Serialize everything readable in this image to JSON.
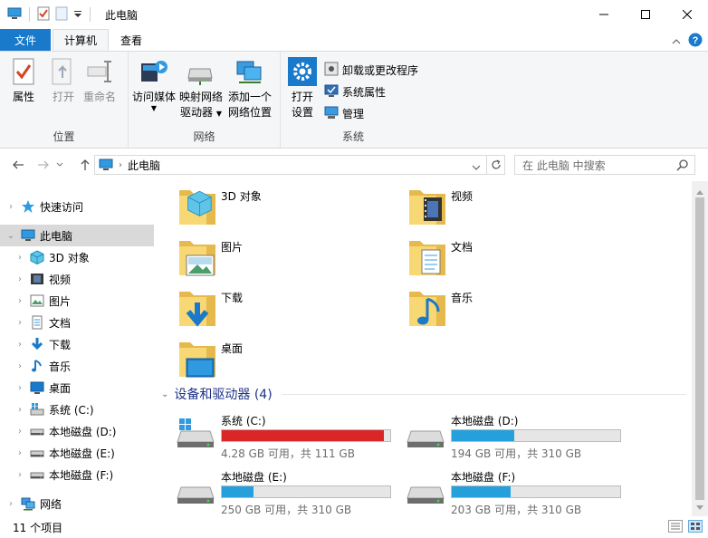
{
  "window": {
    "title": "此电脑"
  },
  "ribbon_tabs": {
    "file": "文件",
    "computer": "计算机",
    "view": "查看"
  },
  "ribbon": {
    "location": {
      "label": "位置",
      "properties": "属性",
      "open": "打开",
      "rename": "重命名"
    },
    "network": {
      "label": "网络",
      "access_media": "访问媒体",
      "map_drive_line1": "映射网络",
      "map_drive_line2": "驱动器",
      "add_location_line1": "添加一个",
      "add_location_line2": "网络位置"
    },
    "system": {
      "label": "系统",
      "open_settings_line1": "打开",
      "open_settings_line2": "设置",
      "uninstall": "卸载或更改程序",
      "system_properties": "系统属性",
      "manage": "管理"
    }
  },
  "address": {
    "crumb": "此电脑",
    "search_placeholder": "在 此电脑 中搜索"
  },
  "navpane": {
    "quick_access": "快速访问",
    "this_pc": "此电脑",
    "items": [
      {
        "label": "3D 对象",
        "icon": "3d-objects-icon"
      },
      {
        "label": "视频",
        "icon": "videos-icon"
      },
      {
        "label": "图片",
        "icon": "pictures-icon"
      },
      {
        "label": "文档",
        "icon": "documents-icon"
      },
      {
        "label": "下载",
        "icon": "downloads-icon"
      },
      {
        "label": "音乐",
        "icon": "music-icon"
      },
      {
        "label": "桌面",
        "icon": "desktop-icon"
      },
      {
        "label": "系统 (C:)",
        "icon": "windows-drive-icon"
      },
      {
        "label": "本地磁盘 (D:)",
        "icon": "drive-icon"
      },
      {
        "label": "本地磁盘 (E:)",
        "icon": "drive-icon"
      },
      {
        "label": "本地磁盘 (F:)",
        "icon": "drive-icon"
      }
    ],
    "network": "网络"
  },
  "folders": [
    {
      "name": "3D 对象",
      "icon": "3d-objects-icon"
    },
    {
      "name": "视频",
      "icon": "videos-icon"
    },
    {
      "name": "图片",
      "icon": "pictures-icon"
    },
    {
      "name": "文档",
      "icon": "documents-icon"
    },
    {
      "name": "下载",
      "icon": "downloads-icon"
    },
    {
      "name": "音乐",
      "icon": "music-icon"
    },
    {
      "name": "桌面",
      "icon": "desktop-icon"
    }
  ],
  "devices": {
    "header": "设备和驱动器 (4)",
    "drives": [
      {
        "name": "系统 (C:)",
        "info": "4.28 GB 可用，共 111 GB",
        "used_fraction": 0.96,
        "color": "#da2626"
      },
      {
        "name": "本地磁盘 (D:)",
        "info": "194 GB 可用，共 310 GB",
        "used_fraction": 0.37,
        "color": "#26a0da"
      },
      {
        "name": "本地磁盘 (E:)",
        "info": "250 GB 可用，共 310 GB",
        "used_fraction": 0.19,
        "color": "#26a0da"
      },
      {
        "name": "本地磁盘 (F:)",
        "info": "203 GB 可用，共 310 GB",
        "used_fraction": 0.35,
        "color": "#26a0da"
      }
    ]
  },
  "status": {
    "count": "11 个项目"
  },
  "colors": {
    "accent": "#1979ca",
    "folder_yellow": "#f8d775",
    "selection": "#d9d9d9"
  }
}
